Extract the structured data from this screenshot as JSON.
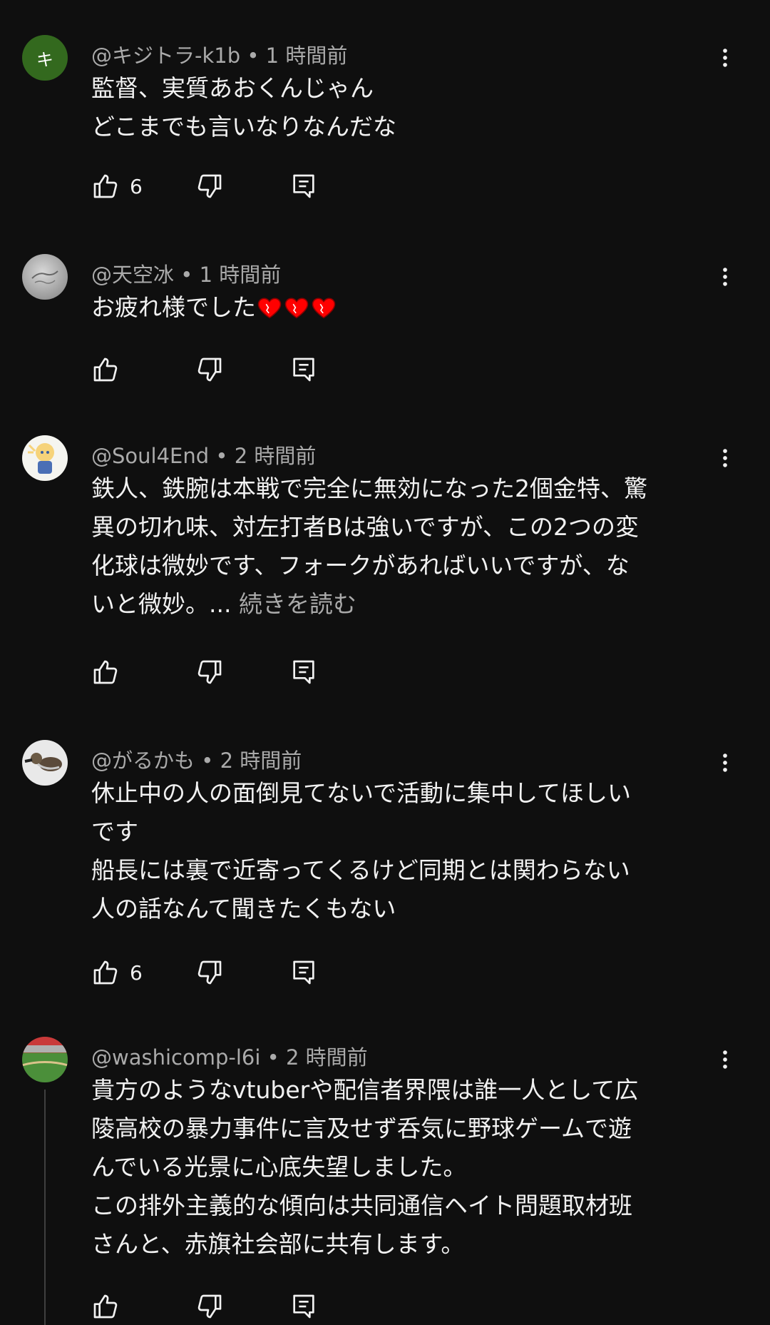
{
  "colors": {
    "background": "#0f0f0f",
    "text_primary": "#f1f1f1",
    "text_secondary": "#aaaaaa",
    "avatar_green": "#33691e",
    "heart_red": "#ff0000"
  },
  "comments": [
    {
      "avatar_letter": "キ",
      "author": "@キジトラ-k1b",
      "time": "1 時間前",
      "lines": [
        "監督、実質あおくんじゃん",
        "どこまでも言いなりなんだな"
      ],
      "likes": "6"
    },
    {
      "author": "@天空冰",
      "time": "1 時間前",
      "lines": [
        "お疲れ様でした"
      ],
      "emoji": [
        "heart-emoji",
        "heart-emoji",
        "heart-emoji"
      ],
      "likes": ""
    },
    {
      "author": "@Soul4End",
      "time": "2 時間前",
      "lines": [
        "鉄人、鉄腕は本戦で完全に無効になった2個金特、驚",
        "異の切れ味、対左打者Bは強いですが、この2つの変",
        "化球は微妙です、フォークがあればいいですが、な",
        "いと微妙。..."
      ],
      "read_more": "続きを読む",
      "likes": ""
    },
    {
      "author": "@がるかも",
      "time": "2 時間前",
      "lines": [
        "休止中の人の面倒見てないで活動に集中してほしい",
        "です",
        "船長には裏で近寄ってくるけど同期とは関わらない",
        "人の話なんて聞きたくもない"
      ],
      "likes": "6"
    },
    {
      "author": "@washicomp-l6i",
      "time": "2 時間前",
      "lines": [
        "貴方のようなvtuberや配信者界隈は誰一人として広",
        "陵高校の暴力事件に言及せず呑気に野球ゲームで遊",
        "んでいる光景に心底失望しました。",
        "この排外主義的な傾向は共同通信ヘイト問題取材班",
        "さんと、赤旗社会部に共有します。"
      ],
      "likes": ""
    }
  ]
}
